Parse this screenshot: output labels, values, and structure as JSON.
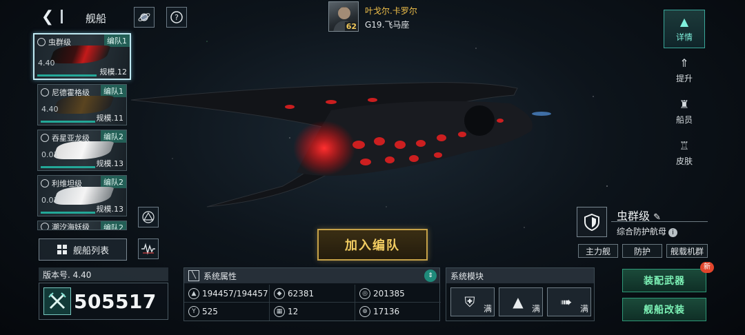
{
  "header": {
    "title": "舰船",
    "commander": {
      "name": "叶戈尔.卡罗尔",
      "level": "62",
      "location": "G19.飞马座"
    }
  },
  "ship_list": [
    {
      "name": "虫群级",
      "fleet": "编队1",
      "version": "4.40",
      "scale": "规模.12",
      "active": true
    },
    {
      "name": "尼德霍格级",
      "fleet": "编队1",
      "version": "4.40",
      "scale": "规模.11"
    },
    {
      "name": "吞星亚龙级",
      "fleet": "编队2",
      "version": "0.01",
      "scale": "规模.13"
    },
    {
      "name": "利维坦级",
      "fleet": "编队2",
      "version": "0.01",
      "scale": "规模.13"
    },
    {
      "name": "潮汐海妖级",
      "fleet": "编队2"
    }
  ],
  "ship_list_button": "舰船列表",
  "version_label": "版本号. 4.40",
  "power_value": "505517",
  "join_button": "加入编队",
  "attributes": {
    "title": "系统属性",
    "items": [
      {
        "icon": "hull-icon",
        "value": "194457/194457"
      },
      {
        "icon": "armor-icon",
        "value": "62381"
      },
      {
        "icon": "shield-stat-icon",
        "value": "201385"
      },
      {
        "icon": "speed-icon",
        "value": "525"
      },
      {
        "icon": "grid-icon",
        "value": "12"
      },
      {
        "icon": "target-icon",
        "value": "17136"
      }
    ]
  },
  "modules": {
    "title": "系统模块",
    "slots": [
      {
        "icon": "shield-plus-icon",
        "status": "满"
      },
      {
        "icon": "mountain-icon",
        "status": "满"
      },
      {
        "icon": "arrows-icon",
        "status": "满"
      }
    ]
  },
  "tabs": [
    {
      "label": "详情",
      "active": true
    },
    {
      "label": "提升"
    },
    {
      "label": "船员"
    },
    {
      "label": "皮肤"
    }
  ],
  "ship_info": {
    "name": "虫群级",
    "type": "综合防护航母",
    "tags": [
      "主力舰",
      "防护",
      "舰载机群"
    ]
  },
  "buttons": {
    "equip": "装配武器",
    "modify": "舰船改装",
    "new_badge": "新"
  },
  "colors": {
    "accent_teal": "#3aa89a",
    "gold": "#f2cd62",
    "ship_glow": "#ff2a2a"
  }
}
